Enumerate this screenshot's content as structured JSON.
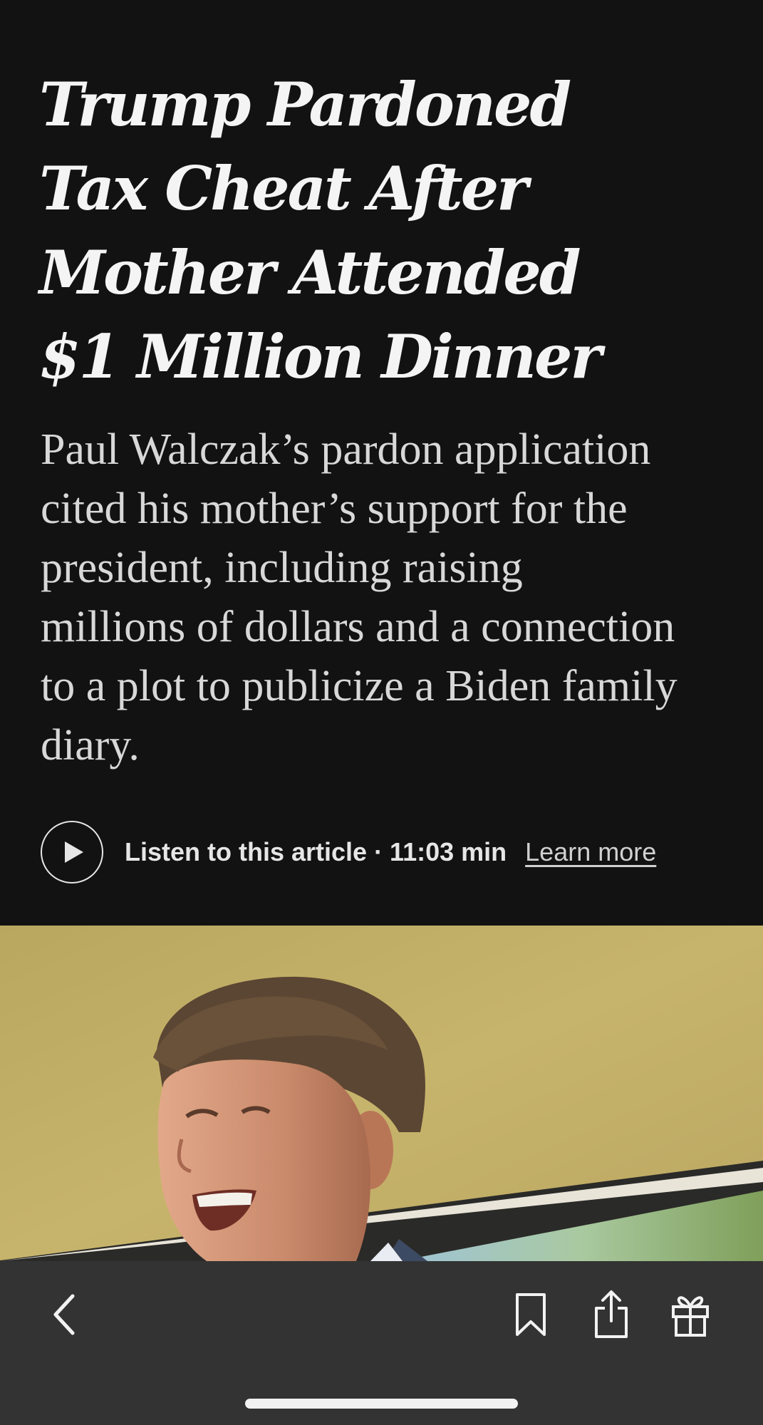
{
  "article": {
    "headline_lines": [
      "Trump Pardoned",
      "Tax Cheat After",
      "Mother Attended",
      "$1 Million Dinner"
    ],
    "summary_lines": [
      "Paul Walczak’s pardon application",
      "cited his mother’s support for the",
      "president, including raising",
      "millions of dollars and a connection",
      "to a plot to publicize a Biden family",
      "diary."
    ]
  },
  "audio": {
    "listen_label": "Listen to this article · 11:03 min",
    "learn_more": "Learn more",
    "play_icon": "play-icon"
  },
  "toolbar": {
    "icons": [
      "chevron-left-icon",
      "bookmark-icon",
      "share-icon",
      "gift-icon"
    ]
  },
  "colors": {
    "header_background": "#121212",
    "headline_text": "#f4f4f4",
    "summary_text": "#d8d8d8",
    "toolbar_background": "#333333",
    "home_indicator": "#f2f2f2"
  }
}
